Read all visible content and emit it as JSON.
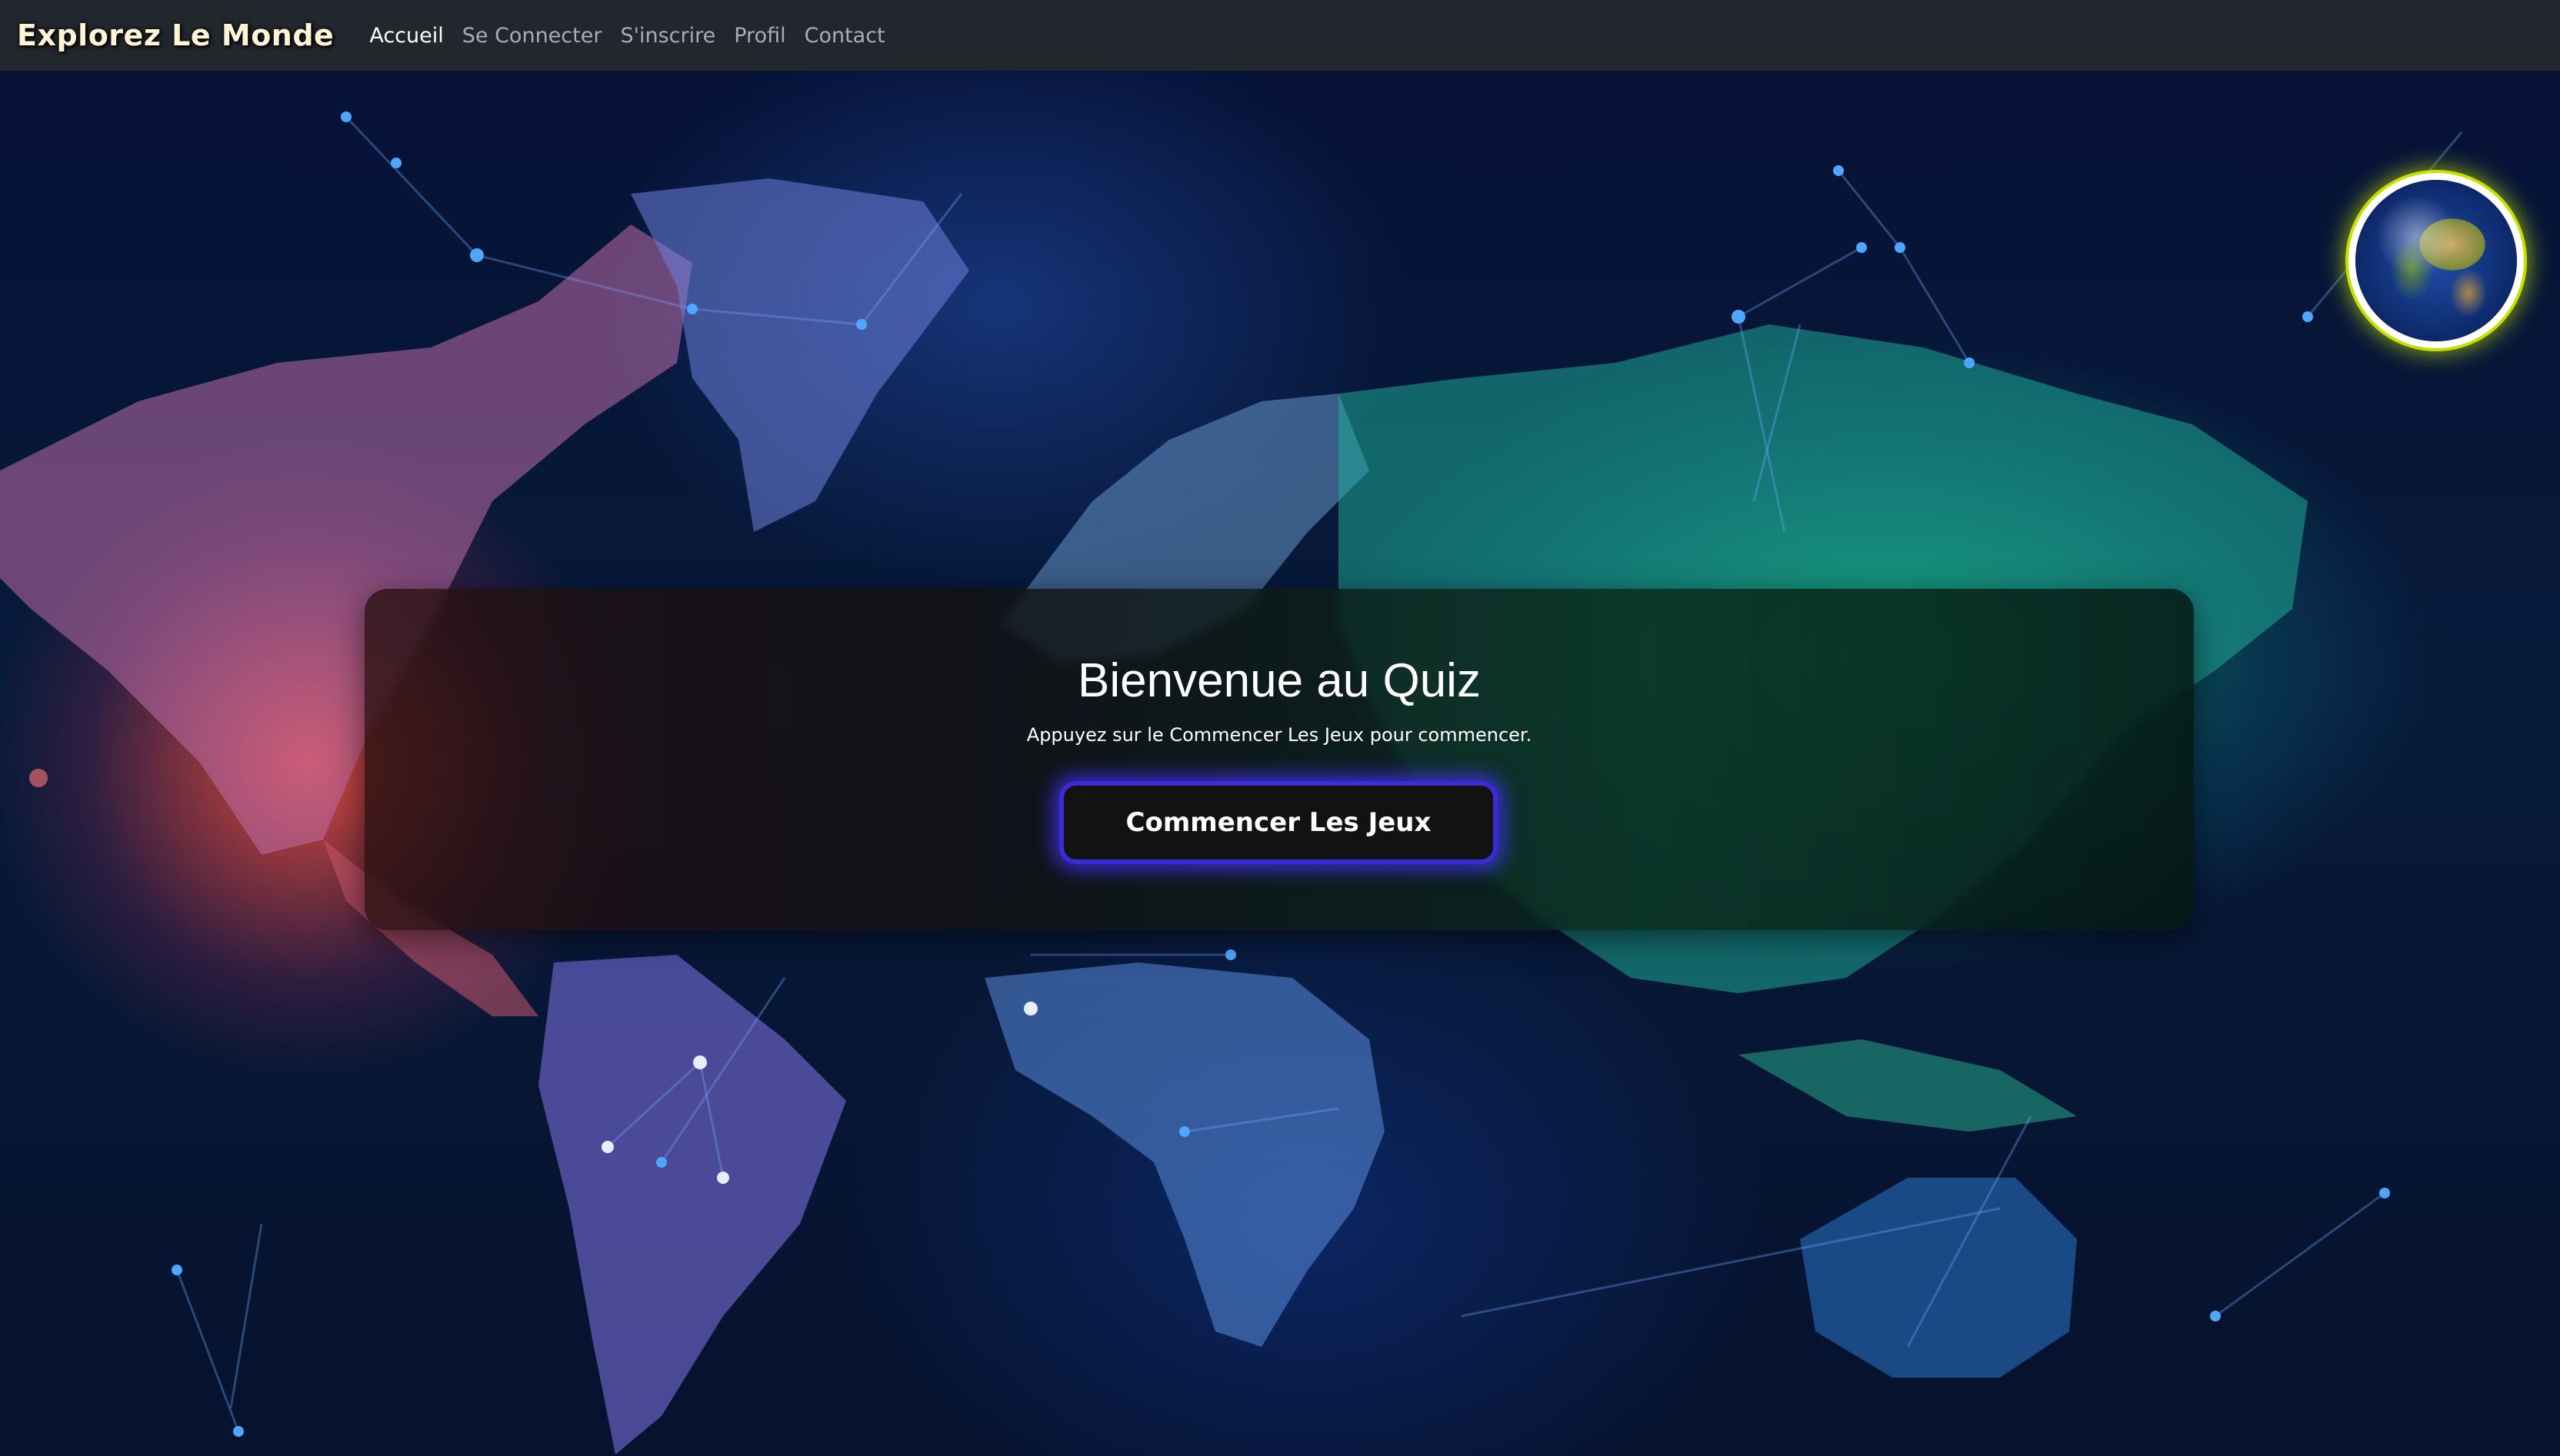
{
  "navbar": {
    "brand": "Explorez Le Monde",
    "links": [
      {
        "label": "Accueil",
        "active": true
      },
      {
        "label": "Se Connecter",
        "active": false
      },
      {
        "label": "S'inscrire",
        "active": false
      },
      {
        "label": "Profil",
        "active": false
      },
      {
        "label": "Contact",
        "active": false
      }
    ]
  },
  "hero": {
    "title": "Bienvenue au Quiz",
    "subtitle": "Appuyez sur le Commencer Les Jeux pour commencer.",
    "start_button": "Commencer Les Jeux"
  },
  "background": {
    "image": "world-map-network-icon"
  },
  "globe": {
    "icon": "earth-globe-icon"
  },
  "colors": {
    "navbar_bg": "#22272d",
    "button_border": "#3a2bd6",
    "globe_ring": "#c8e000"
  }
}
